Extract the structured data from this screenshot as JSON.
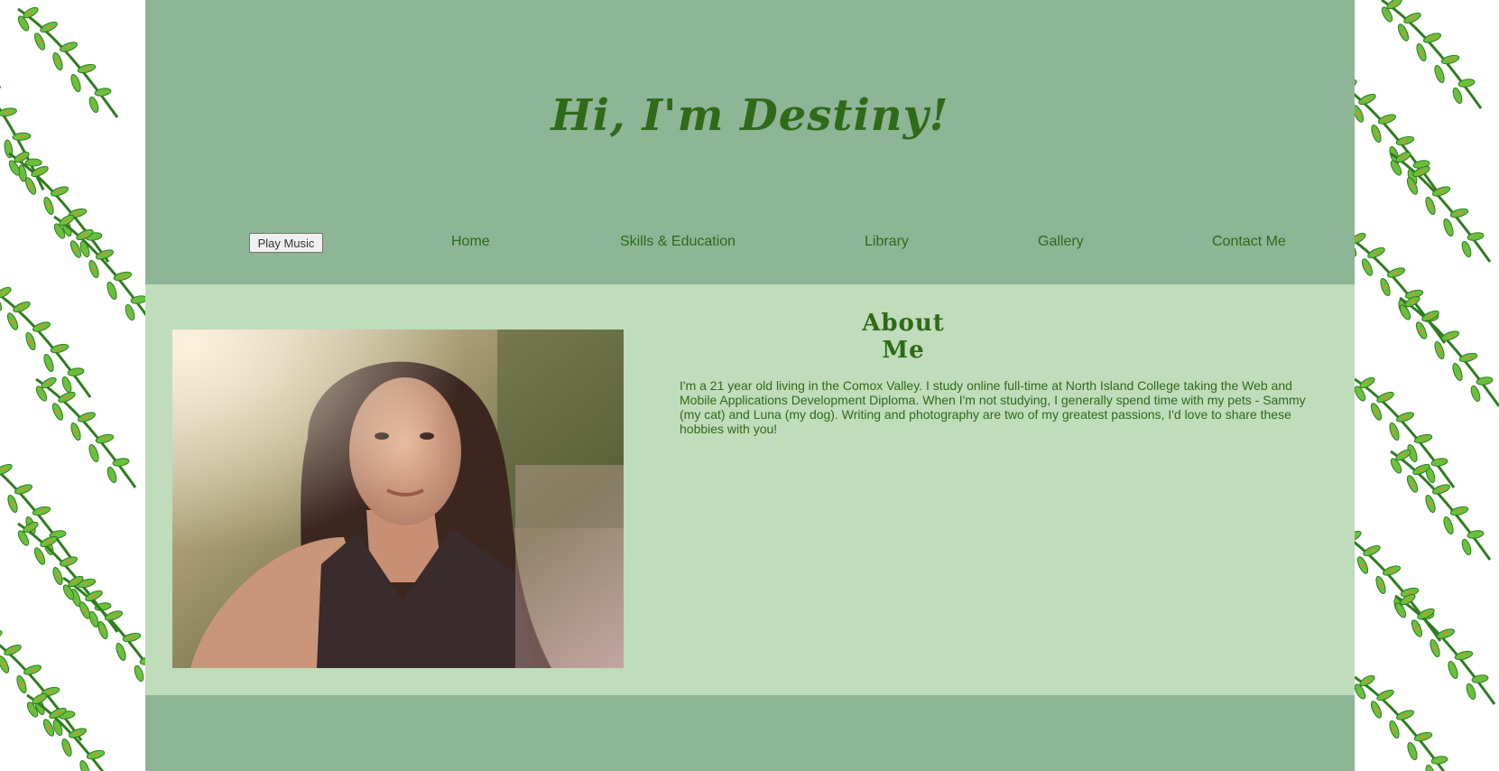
{
  "site": {
    "title": "Hi, I'm Destiny!"
  },
  "nav": {
    "music_button": "Play Music",
    "links": [
      "Home",
      "Skills & Education",
      "Library",
      "Gallery",
      "Contact Me"
    ]
  },
  "about": {
    "heading_line1": "About",
    "heading_line2": "Me",
    "body": "I'm a 21 year old living in the Comox Valley. I study online full-time at North Island College taking the Web and Mobile Applications Development Diploma. When I'm not studying, I generally spend time with my pets - Sammy (my cat) and Luna (my dog). Writing and photography are two of my greatest passions, I'd love to share these hobbies with you!"
  },
  "colors": {
    "header_bg": "#8db596",
    "section_bg": "#bfdcbb",
    "text_green": "#2f6a18",
    "fern_green": "#5fae3a",
    "fern_dark": "#2e7d1f",
    "fern_orange": "#e58a2a"
  }
}
